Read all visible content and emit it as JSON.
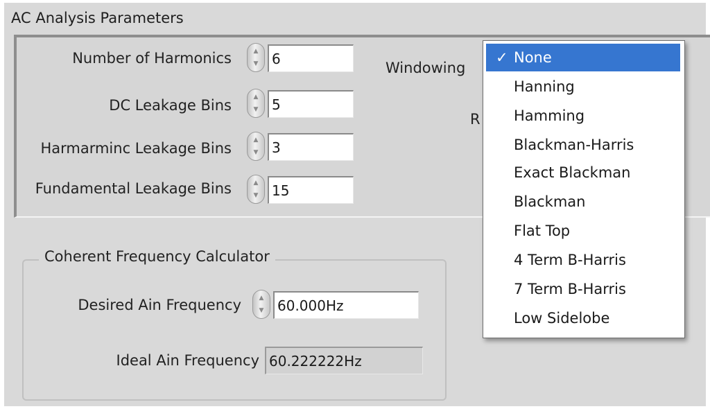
{
  "panel": {
    "title": "AC Analysis Parameters"
  },
  "params": [
    {
      "label": "Number of Harmonics",
      "value": "6"
    },
    {
      "label": "DC Leakage Bins",
      "value": "5"
    },
    {
      "label": "Harmarminc Leakage Bins",
      "value": "3"
    },
    {
      "label": "Fundamental Leakage Bins",
      "value": "15"
    }
  ],
  "windowing": {
    "label": "Windowing",
    "partial_label": "R",
    "options": [
      {
        "label": "None",
        "check": "✓"
      },
      {
        "label": "Hanning"
      },
      {
        "label": "Hamming"
      },
      {
        "label": "Blackman-Harris"
      },
      {
        "label": "Exact Blackman"
      },
      {
        "label": "Blackman"
      },
      {
        "label": "Flat Top"
      },
      {
        "label": "4 Term B-Harris"
      },
      {
        "label": "7 Term B-Harris"
      },
      {
        "label": "Low Sidelobe"
      }
    ]
  },
  "coherent": {
    "title": "Coherent Frequency Calculator",
    "desired_label": "Desired Ain Frequency",
    "desired_value": "60.000Hz",
    "ideal_label": "Ideal Ain Frequency",
    "ideal_value": "60.222222Hz"
  }
}
